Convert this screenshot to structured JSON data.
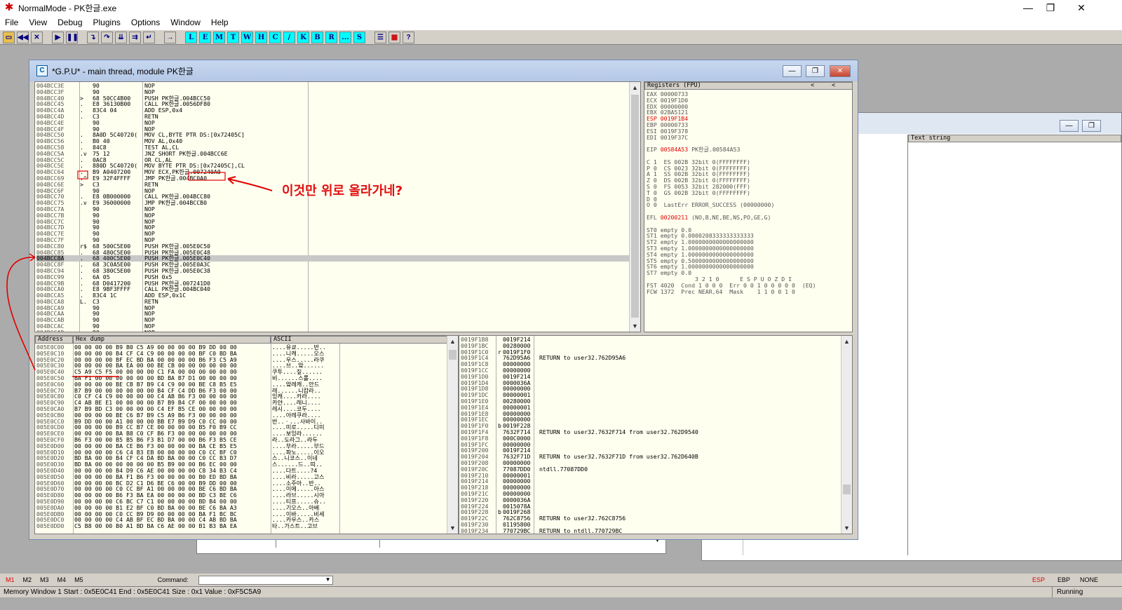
{
  "app": {
    "title": "NormalMode - PK한글.exe"
  },
  "menu": [
    "File",
    "View",
    "Debug",
    "Plugins",
    "Options",
    "Window",
    "Help"
  ],
  "toolbar": {
    "letters": [
      "L",
      "E",
      "M",
      "T",
      "W",
      "H",
      "C",
      "/",
      "K",
      "B",
      "R",
      "...",
      "S"
    ]
  },
  "gpu": {
    "title": "*G.P.U* - main thread, module PK한글",
    "disasm": [
      {
        "a": "004BCC3E",
        "m": " ",
        "h": "90",
        "i": "NOP"
      },
      {
        "a": "004BCC3F",
        "m": " ",
        "h": "90",
        "i": "NOP"
      },
      {
        "a": "004BCC40",
        "m": ">",
        "h": "68 50CC4B00",
        "i": "PUSH PK한글.004BCC50"
      },
      {
        "a": "004BCC45",
        "m": ".",
        "h": "E8 36130B00",
        "i": "CALL PK한글.0056DF80"
      },
      {
        "a": "004BCC4A",
        "m": ".",
        "h": "83C4 04",
        "i": "ADD ESP,0x4"
      },
      {
        "a": "004BCC4D",
        "m": ".",
        "h": "C3",
        "i": "RETN"
      },
      {
        "a": "004BCC4E",
        "m": " ",
        "h": "90",
        "i": "NOP"
      },
      {
        "a": "004BCC4F",
        "m": " ",
        "h": "90",
        "i": "NOP"
      },
      {
        "a": "004BCC50",
        "m": ".",
        "h": "8A0D 5C40720(",
        "i": "MOV CL,BYTE PTR DS:[0x72405C]"
      },
      {
        "a": "004BCC56",
        "m": ".",
        "h": "B0 40",
        "i": "MOV AL,0x40"
      },
      {
        "a": "004BCC58",
        "m": ".",
        "h": "84C8",
        "i": "TEST AL,CL"
      },
      {
        "a": "004BCC5A",
        "m": ".v",
        "h": "75 12",
        "i": "JNZ SHORT PK한글.004BCC6E"
      },
      {
        "a": "004BCC5C",
        "m": ".",
        "h": "0AC8",
        "i": "OR CL,AL"
      },
      {
        "a": "004BCC5E",
        "m": ".",
        "h": "880D 5C40720(",
        "i": "MOV BYTE PTR DS:[0x72405C],CL"
      },
      {
        "a": "004BCC64",
        "m": ".",
        "h": "B9 A0407200",
        "i": "MOV ECX,PK한글.007240A0"
      },
      {
        "a": "004BCC69",
        "m": ".^",
        "h": "E9 32F4FFFF",
        "i": "JMP PK한글.004BC0A0"
      },
      {
        "a": "004BCC6E",
        "m": ">",
        "h": "C3",
        "i": "RETN"
      },
      {
        "a": "004BCC6F",
        "m": " ",
        "h": "90",
        "i": "NOP"
      },
      {
        "a": "004BCC70",
        "m": ".",
        "h": "E8 0B000000",
        "i": "CALL PK한글.004BCC80"
      },
      {
        "a": "004BCC75",
        "m": ".v",
        "h": "E9 36000000",
        "i": "JMP PK한글.004BCCB0"
      },
      {
        "a": "004BCC7A",
        "m": " ",
        "h": "90",
        "i": "NOP"
      },
      {
        "a": "004BCC7B",
        "m": " ",
        "h": "90",
        "i": "NOP"
      },
      {
        "a": "004BCC7C",
        "m": " ",
        "h": "90",
        "i": "NOP"
      },
      {
        "a": "004BCC7D",
        "m": " ",
        "h": "90",
        "i": "NOP"
      },
      {
        "a": "004BCC7E",
        "m": " ",
        "h": "90",
        "i": "NOP"
      },
      {
        "a": "004BCC7F",
        "m": " ",
        "h": "90",
        "i": "NOP"
      },
      {
        "a": "004BCC80",
        "m": "r$",
        "h": "68 500C5E00",
        "i": "PUSH PK한글.005E0C50"
      },
      {
        "a": "004BCC85",
        "m": ".",
        "h": "68 480C5E00",
        "i": "PUSH PK한글.005E0C48"
      },
      {
        "a": "004BCC8A",
        "m": ".",
        "h": "68 400C5E00",
        "i": "PUSH PK한글.005E0C40"
      },
      {
        "a": "004BCC8F",
        "m": ".",
        "h": "68 3C0A5E00",
        "i": "PUSH PK한글.005E0A3C"
      },
      {
        "a": "004BCC94",
        "m": ".",
        "h": "68 380C5E00",
        "i": "PUSH PK한글.005E0C38"
      },
      {
        "a": "004BCC99",
        "m": ".",
        "h": "6A 05",
        "i": "PUSH 0x5"
      },
      {
        "a": "004BCC9B",
        "m": ".",
        "h": "68 D0417200",
        "i": "PUSH PK한글.007241D0"
      },
      {
        "a": "004BCCA0",
        "m": ".",
        "h": "E8 9BF3FFFF",
        "i": "CALL PK한글.004BC040"
      },
      {
        "a": "004BCCA5",
        "m": ".",
        "h": "83C4 1C",
        "i": "ADD ESP,0x1C"
      },
      {
        "a": "004BCCA8",
        "m": "L.",
        "h": "C3",
        "i": "RETN"
      },
      {
        "a": "004BCCA9",
        "m": " ",
        "h": "90",
        "i": "NOP"
      },
      {
        "a": "004BCCAA",
        "m": " ",
        "h": "90",
        "i": "NOP"
      },
      {
        "a": "004BCCAB",
        "m": " ",
        "h": "90",
        "i": "NOP"
      },
      {
        "a": "004BCCAC",
        "m": " ",
        "h": "90",
        "i": "NOP"
      },
      {
        "a": "004BCCAD",
        "m": " ",
        "h": "90",
        "i": "NOP"
      }
    ],
    "registers": {
      "title": "Registers (FPU)",
      "lines": [
        {
          "t": "EAX 00000733",
          "c": ""
        },
        {
          "t": "ECX 0019F1D0",
          "c": ""
        },
        {
          "t": "EDX 00000000",
          "c": ""
        },
        {
          "t": "EBX 02BA5121",
          "c": ""
        },
        {
          "t": "ESP 0019F1B4",
          "c": "red"
        },
        {
          "t": "EBP 00000733",
          "c": ""
        },
        {
          "t": "ESI 0019F378",
          "c": ""
        },
        {
          "t": "EDI 0019F37C",
          "c": ""
        },
        {
          "t": "",
          "c": ""
        },
        {
          "t": "EIP 00584A53 PK한글.00584A53",
          "c": "eip"
        },
        {
          "t": "",
          "c": ""
        },
        {
          "t": "C 1  ES 002B 32bit 0(FFFFFFFF)",
          "c": ""
        },
        {
          "t": "P 0  CS 0023 32bit 0(FFFFFFFF)",
          "c": ""
        },
        {
          "t": "A 1  SS 002B 32bit 0(FFFFFFFF)",
          "c": ""
        },
        {
          "t": "Z 0  DS 002B 32bit 0(FFFFFFFF)",
          "c": ""
        },
        {
          "t": "S 0  FS 0053 32bit 282000(FFF)",
          "c": ""
        },
        {
          "t": "T 0  GS 002B 32bit 0(FFFFFFFF)",
          "c": ""
        },
        {
          "t": "D 0",
          "c": ""
        },
        {
          "t": "O 0  LastErr ERROR_SUCCESS (00000000)",
          "c": ""
        },
        {
          "t": "",
          "c": ""
        },
        {
          "t": "EFL 00200211 (NO,B,NE,BE,NS,PO,GE,G)",
          "c": "efl"
        },
        {
          "t": "",
          "c": ""
        },
        {
          "t": "ST0 empty 0.0",
          "c": ""
        },
        {
          "t": "ST1 empty 0.0000208333333333333",
          "c": ""
        },
        {
          "t": "ST2 empty 1.0000000000000000000",
          "c": ""
        },
        {
          "t": "ST3 empty 1.0000000000000000000",
          "c": ""
        },
        {
          "t": "ST4 empty 1.0000000000000000000",
          "c": ""
        },
        {
          "t": "ST5 empty 0.5000000000000000000",
          "c": ""
        },
        {
          "t": "ST6 empty 1.0000000000000000000",
          "c": ""
        },
        {
          "t": "ST7 empty 0.0",
          "c": ""
        },
        {
          "t": "              3 2 1 0      E S P U O Z D I",
          "c": ""
        },
        {
          "t": "FST 4020  Cond 1 0 0 0  Err 0 0 1 0 0 0 0 0  (EQ)",
          "c": ""
        },
        {
          "t": "FCW 1372  Prec NEAR,64  Mask    1 1 0 0 1 0",
          "c": ""
        }
      ]
    },
    "dump": {
      "col_address": "Address",
      "col_hex": "Hex dump",
      "col_ascii": "ASCII",
      "rows": [
        {
          "a": "005E0C00",
          "h": "00 00 00 00 B9 B0 C5 A9 00 00 00 00 B9 DD 00 00",
          "s": "....유쿄.....반.."
        },
        {
          "a": "005E0C10",
          "h": "00 00 00 00 B4 CF C4 C9 00 00 00 00 BF C0 BD BA",
          "s": "....니캐.....오스"
        },
        {
          "a": "005E0C20",
          "h": "00 00 00 00 BF EC BD BA 00 00 00 00 B6 F3 C5 A9",
          "s": "....우스.....라쿠"
        },
        {
          "a": "005E0C30",
          "h": "00 00 00 00 BA EA 00 00 BE CB 00 00 00 00 00 00",
          "s": "....브..앜......"
        },
        {
          "a": "005E0C40",
          "h": "C5 A9 C5 F5 00 00 00 00 C1 FA 00 00 00 00 00 00",
          "s": "쿠투....짚......"
        },
        {
          "a": "005E0C50",
          "h": "BA F1 00 00 00 00 00 00 BD BA B7 D1 00 00 00 00",
          "s": "비......스롤...."
        },
        {
          "a": "005E0C60",
          "h": "00 00 00 00 BE CB B7 B9 C4 C9 00 00 BE C8 B5 E5",
          "s": "....앜레캐..안드"
        },
        {
          "a": "005E0C70",
          "h": "B7 B9 00 00 00 00 00 00 B4 CF C4 DD B6 F3 00 00",
          "s": "레......니캄라.."
        },
        {
          "a": "005E0C80",
          "h": "C0 CF C4 C9 00 00 00 00 C4 AB B6 F3 00 00 00 00",
          "s": "잉캐....카라...."
        },
        {
          "a": "005E0C90",
          "h": "C4 AB BE E1 00 00 00 00 B7 B9 B4 CF 00 00 00 00",
          "s": "카얀....레니...."
        },
        {
          "a": "005E0CA0",
          "h": "B7 B9 BD C3 00 00 00 00 C4 EF B5 CE 00 00 00 00",
          "s": "레시....코두...."
        },
        {
          "a": "005E0CB0",
          "h": "00 00 00 00 BE C6 B7 B9 C5 A9 B6 F3 00 00 00 00",
          "s": "....아레쿠라...."
        },
        {
          "a": "005E0CC0",
          "h": "B9 DD 00 00 A1 00 00 00 BB E7 B9 D9 C0 CC 00 00",
          "s": "반..ㆍ...사바이.."
        },
        {
          "a": "005E0CD0",
          "h": "00 00 00 00 B9 CC B7 CE 00 00 00 00 B5 F0 B9 CC",
          "s": "....미로.....디미"
        },
        {
          "a": "005E0CE0",
          "h": "00 00 00 00 BA B8 C0 CF B6 F3 00 00 00 00 00 00",
          "s": "....보잉라......"
        },
        {
          "a": "005E0CF0",
          "h": "B6 F3 00 00 B5 B5 B6 F3 B1 D7 00 00 B6 F3 B5 CE",
          "s": "라..도라그..라두"
        },
        {
          "a": "005E0D00",
          "h": "00 00 00 00 BA CE B6 F3 00 00 00 00 BA CE B5 E5",
          "s": "....부라.....부드"
        },
        {
          "a": "005E0D10",
          "h": "00 00 00 00 C6 C4 B3 EB 00 00 00 00 C0 CC BF C0",
          "s": "....파노.....이오"
        },
        {
          "a": "005E0D20",
          "h": "BD BA 00 00 B4 CF C4 DA BD BA 00 00 C0 CC B3 D7",
          "s": "스..니코스..이네"
        },
        {
          "a": "005E0D30",
          "h": "BD BA 00 00 00 00 00 00 B5 B9 00 00 B6 EC 00 00",
          "s": "스......드..띠.."
        },
        {
          "a": "005E0D40",
          "h": "00 00 00 00 B4 D9 C6 AE 00 00 00 00 C8 34 B3 C4",
          "s": "....다트....?4"
        },
        {
          "a": "005E0D50",
          "h": "00 00 00 00 BA F1 B6 F3 00 00 00 00 B0 ED BD BA",
          "s": "....비라.....고스"
        },
        {
          "a": "005E0D60",
          "h": "00 00 00 00 BC D2 C1 D6 BE C6 00 00 B9 DD 00 00",
          "s": "....소주아..반.."
        },
        {
          "a": "005E0D70",
          "h": "00 00 00 00 C0 CC BF A1 00 00 00 00 BE C6 BD BA",
          "s": "....이에.....아스"
        },
        {
          "a": "005E0D80",
          "h": "00 00 00 00 B6 F3 BA EA 00 00 00 00 BD C3 BE C6",
          "s": "....라브.....시아"
        },
        {
          "a": "005E0D90",
          "h": "00 00 00 00 C6 BC C7 C1 00 00 00 00 BD B4 00 00",
          "s": "....티프.....슈.."
        },
        {
          "a": "005E0DA0",
          "h": "00 00 00 00 B1 E2 BF C0 BD BA 00 00 BE C6 BA A3",
          "s": "....기오스..아베"
        },
        {
          "a": "005E0DB0",
          "h": "00 00 00 00 C0 CC B9 D9 00 00 00 00 BA F1 BC BC",
          "s": "....이바.....비세"
        },
        {
          "a": "005E0DC0",
          "h": "00 00 00 00 C4 AB BF EC BD BA 00 00 C4 AB BD BA",
          "s": "....카우스..카스"
        },
        {
          "a": "005E0DD0",
          "h": "C5 B8 00 00 B0 A1 BD BA C6 AE 00 00 B1 B3 BA EA",
          "s": "타..가스트..고브"
        }
      ]
    },
    "stack": [
      {
        "a": "0019F1B8",
        "m": " ",
        "v": "0019F214",
        "c": ""
      },
      {
        "a": "0019F1BC",
        "m": " ",
        "v": "00280000",
        "c": ""
      },
      {
        "a": "0019F1C0",
        "m": "r",
        "v": "0019F1F0",
        "c": ""
      },
      {
        "a": "0019F1C4",
        "m": " ",
        "v": "762D95A6",
        "c": "RETURN to user32.762D95A6"
      },
      {
        "a": "0019F1C8",
        "m": " ",
        "v": "00000000",
        "c": ""
      },
      {
        "a": "0019F1CC",
        "m": " ",
        "v": "00000000",
        "c": ""
      },
      {
        "a": "0019F1D0",
        "m": " ",
        "v": "0019F214",
        "c": ""
      },
      {
        "a": "0019F1D4",
        "m": " ",
        "v": "0000036A",
        "c": ""
      },
      {
        "a": "0019F1D8",
        "m": " ",
        "v": "00000000",
        "c": ""
      },
      {
        "a": "0019F1DC",
        "m": " ",
        "v": "00000001",
        "c": ""
      },
      {
        "a": "0019F1E0",
        "m": " ",
        "v": "00280000",
        "c": ""
      },
      {
        "a": "0019F1E4",
        "m": " ",
        "v": "00000001",
        "c": ""
      },
      {
        "a": "0019F1E8",
        "m": " ",
        "v": "00000000",
        "c": ""
      },
      {
        "a": "0019F1EC",
        "m": " ",
        "v": "00000000",
        "c": ""
      },
      {
        "a": "0019F1F0",
        "m": "b",
        "v": "0019F228",
        "c": ""
      },
      {
        "a": "0019F1F4",
        "m": " ",
        "v": "7632F714",
        "c": "RETURN to user32.7632F714 from user32.762D9540"
      },
      {
        "a": "0019F1F8",
        "m": " ",
        "v": "000C0000",
        "c": ""
      },
      {
        "a": "0019F1FC",
        "m": " ",
        "v": "00000000",
        "c": ""
      },
      {
        "a": "0019F200",
        "m": " ",
        "v": "0019F214",
        "c": ""
      },
      {
        "a": "0019F204",
        "m": " ",
        "v": "7632F71D",
        "c": "RETURN to user32.7632F71D from user32.762D640B"
      },
      {
        "a": "0019F208",
        "m": " ",
        "v": "00000000",
        "c": ""
      },
      {
        "a": "0019F20C",
        "m": " ",
        "v": "77087DD0",
        "c": "ntdll.77087DD0"
      },
      {
        "a": "0019F210",
        "m": " ",
        "v": "00000001",
        "c": ""
      },
      {
        "a": "0019F214",
        "m": " ",
        "v": "00000000",
        "c": ""
      },
      {
        "a": "0019F218",
        "m": " ",
        "v": "00000000",
        "c": ""
      },
      {
        "a": "0019F21C",
        "m": " ",
        "v": "00000000",
        "c": ""
      },
      {
        "a": "0019F220",
        "m": " ",
        "v": "0000036A",
        "c": ""
      },
      {
        "a": "0019F224",
        "m": " ",
        "v": "0015078A",
        "c": ""
      },
      {
        "a": "0019F228",
        "m": "b",
        "v": "0019F268",
        "c": ""
      },
      {
        "a": "0019F22C",
        "m": " ",
        "v": "762C8756",
        "c": "RETURN to user32.762C8756"
      },
      {
        "a": "0019F230",
        "m": " ",
        "v": "01195800",
        "c": ""
      },
      {
        "a": "0019F234",
        "m": " ",
        "v": "770729BC",
        "c": "RETURN to ntdll.770729BC"
      }
    ]
  },
  "annotation": {
    "text": "이것만 위로 올라가네?"
  },
  "background_window": {
    "col_header": "Text string"
  },
  "bottom": {
    "marks": [
      "M1",
      "M2",
      "M3",
      "M4",
      "M5"
    ],
    "command_label": "Command:",
    "registers": [
      "ESP",
      "EBP",
      "NONE"
    ],
    "status_text": "Memory Window 1  Start : 0x5E0C41  End : 0x5E0C41  Size : 0x1 Value : 0xF5C5A9",
    "state": "Running"
  }
}
